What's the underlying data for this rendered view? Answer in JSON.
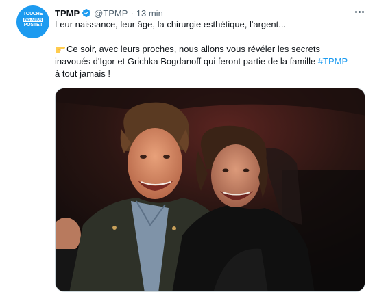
{
  "account": {
    "name": "TPMP",
    "handle": "@TPMP",
    "separator": "·",
    "time": "13 min",
    "avatar_text": [
      "TOUCHE",
      "PAS À MON",
      "POSTE !"
    ]
  },
  "tweet": {
    "line1": "Leur naissance, leur âge, la chirurgie esthétique, l'argent...",
    "line2": "Ce soir, avec leurs proches, nous allons vous révéler les secrets",
    "line3_text": "inavoués d'Igor et Grichka Bogdanoff qui feront partie de la famille ",
    "hashtag": "#TPMP",
    "line4": "à tout jamais !"
  },
  "icons": {
    "verified": "verified-badge-icon",
    "emoji": "pointing-hand-emoji-icon",
    "more": "more-options-icon"
  },
  "colors": {
    "accent": "#1d9bf0",
    "text": "#0f1419",
    "secondary": "#536471",
    "media_border": "#cfd9de"
  }
}
